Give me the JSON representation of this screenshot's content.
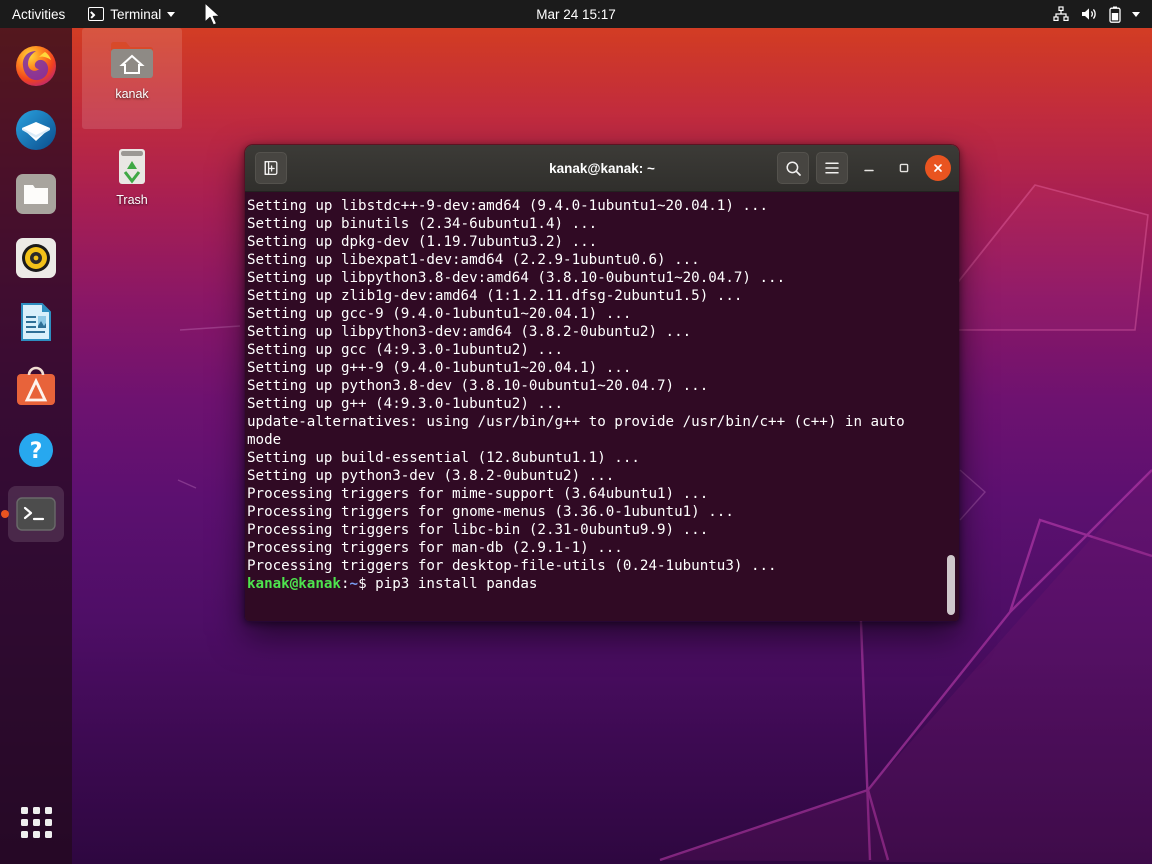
{
  "top_panel": {
    "activities_label": "Activities",
    "app_menu_label": "Terminal",
    "app_menu_icon": "terminal-icon",
    "clock": "Mar 24  15:17",
    "indicators": [
      {
        "name": "network-wired-icon",
        "label": "Network"
      },
      {
        "name": "volume-icon",
        "label": "Volume"
      },
      {
        "name": "battery-icon",
        "label": "Battery"
      },
      {
        "name": "chevron-down-icon",
        "label": "System menu"
      }
    ]
  },
  "dock": {
    "items": [
      {
        "name": "dock-item-firefox",
        "label": "Firefox",
        "icon": "firefox-icon",
        "active": false
      },
      {
        "name": "dock-item-thunderbird",
        "label": "Thunderbird Mail",
        "icon": "thunderbird-icon",
        "active": false
      },
      {
        "name": "dock-item-files",
        "label": "Files",
        "icon": "files-icon",
        "active": false
      },
      {
        "name": "dock-item-rhythmbox",
        "label": "Rhythmbox",
        "icon": "rhythmbox-icon",
        "active": false
      },
      {
        "name": "dock-item-libreoffice-writer",
        "label": "LibreOffice Writer",
        "icon": "libreoffice-writer-icon",
        "active": false
      },
      {
        "name": "dock-item-ubuntu-software",
        "label": "Ubuntu Software",
        "icon": "ubuntu-software-icon",
        "active": false
      },
      {
        "name": "dock-item-help",
        "label": "Help",
        "icon": "help-icon",
        "active": false
      },
      {
        "name": "dock-item-terminal",
        "label": "Terminal",
        "icon": "terminal-icon",
        "active": true
      }
    ],
    "show_apps_label": "Show Applications"
  },
  "desktop_icons": [
    {
      "name": "desktop-icon-home",
      "label": "kanak",
      "icon": "home-folder-icon",
      "selected": true
    },
    {
      "name": "desktop-icon-trash",
      "label": "Trash",
      "icon": "trash-icon",
      "selected": false
    }
  ],
  "terminal": {
    "title": "kanak@kanak: ~",
    "new_tab_label": "New Tab",
    "search_label": "Search",
    "menu_label": "Menu",
    "minimize_label": "–",
    "maximize_label": "□",
    "close_label": "✕",
    "background_color": "#300a24",
    "prompt": {
      "user_host": "kanak@kanak",
      "colon": ":",
      "path": "~",
      "dollar": "$ ",
      "command": "pip3 install pandas"
    },
    "output_lines": [
      "Setting up libstdc++-9-dev:amd64 (9.4.0-1ubuntu1~20.04.1) ...",
      "Setting up binutils (2.34-6ubuntu1.4) ...",
      "Setting up dpkg-dev (1.19.7ubuntu3.2) ...",
      "Setting up libexpat1-dev:amd64 (2.2.9-1ubuntu0.6) ...",
      "Setting up libpython3.8-dev:amd64 (3.8.10-0ubuntu1~20.04.7) ...",
      "Setting up zlib1g-dev:amd64 (1:1.2.11.dfsg-2ubuntu1.5) ...",
      "Setting up gcc-9 (9.4.0-1ubuntu1~20.04.1) ...",
      "Setting up libpython3-dev:amd64 (3.8.2-0ubuntu2) ...",
      "Setting up gcc (4:9.3.0-1ubuntu2) ...",
      "Setting up g++-9 (9.4.0-1ubuntu1~20.04.1) ...",
      "Setting up python3.8-dev (3.8.10-0ubuntu1~20.04.7) ...",
      "Setting up g++ (4:9.3.0-1ubuntu2) ...",
      "update-alternatives: using /usr/bin/g++ to provide /usr/bin/c++ (c++) in auto",
      "mode",
      "Setting up build-essential (12.8ubuntu1.1) ...",
      "Setting up python3-dev (3.8.2-0ubuntu2) ...",
      "Processing triggers for mime-support (3.64ubuntu1) ...",
      "Processing triggers for gnome-menus (3.36.0-1ubuntu1) ...",
      "Processing triggers for libc-bin (2.31-0ubuntu9.9) ...",
      "Processing triggers for man-db (2.9.1-1) ...",
      "Processing triggers for desktop-file-utils (0.24-1ubuntu3) ..."
    ]
  },
  "colors": {
    "ubuntu_orange": "#e95420",
    "terminal_bg": "#300a24",
    "panel_bg": "#1b1b1b",
    "prompt_green": "#4ee44e",
    "prompt_blue": "#7a9ff5"
  }
}
